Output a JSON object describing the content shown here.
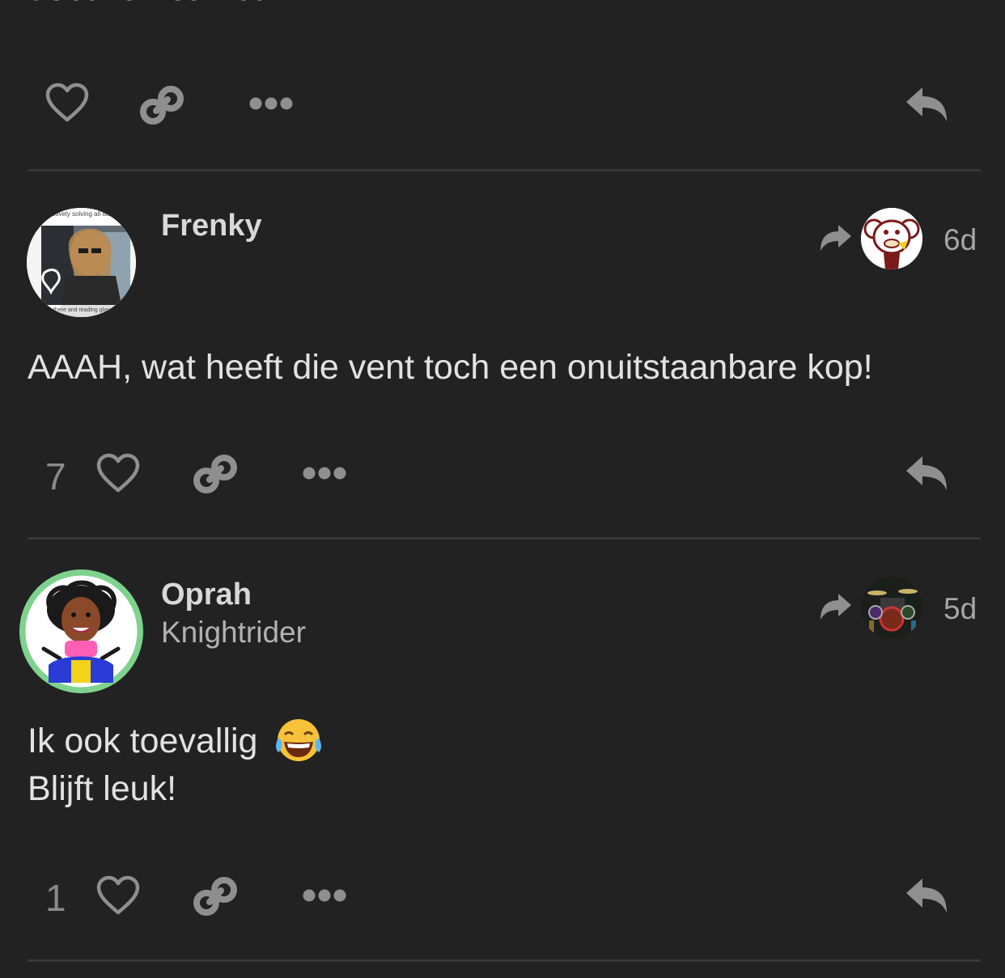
{
  "top_post": {
    "cutoff_text": "doet 'ie het niet..."
  },
  "posts": [
    {
      "username": "Frenky",
      "user_title": "",
      "age": "6d",
      "body_lines": [
        "AAAH, wat heeft die vent toch een onuitstaanbare kop!"
      ],
      "like_count": "7",
      "avatar_caption_top": "begin effectively solving all issues in my",
      "avatar_caption_bottom": "just there and reading glass of"
    },
    {
      "username": "Oprah",
      "user_title": "Knightrider",
      "age": "5d",
      "body_lines": [
        "Ik ook toevallig",
        "Blijft leuk!"
      ],
      "emoji": "joy-emoji",
      "like_count": "1"
    }
  ],
  "icons": {
    "like": "heart-outline-icon",
    "link": "link-icon",
    "more": "ellipsis-icon",
    "reply": "reply-icon",
    "reply_to": "reply-to-arrow-icon"
  },
  "colors": {
    "background": "#222222",
    "divider": "#383838",
    "icon": "#8f8f8f",
    "flair_ring": "#7fd28d"
  }
}
